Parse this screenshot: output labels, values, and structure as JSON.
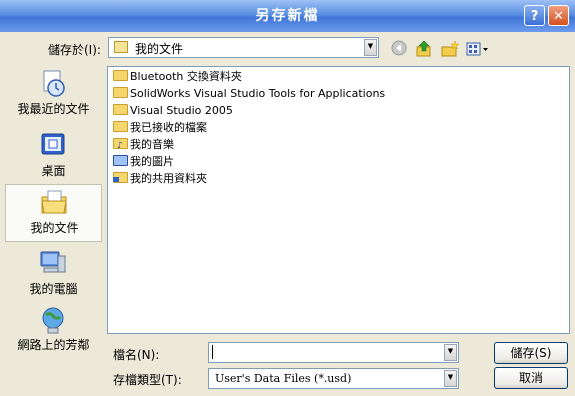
{
  "window": {
    "title": "另存新檔",
    "help_glyph": "?",
    "close_glyph": "✕"
  },
  "save_in": {
    "label": "儲存於(I):",
    "value": "我的文件"
  },
  "toolbar": {
    "icons": [
      "back-icon",
      "up-folder-icon",
      "new-folder-icon",
      "views-menu-icon"
    ]
  },
  "places": [
    {
      "label": "我最近的文件",
      "icon": "recent-documents-icon"
    },
    {
      "label": "桌面",
      "icon": "desktop-icon"
    },
    {
      "label": "我的文件",
      "icon": "my-documents-icon"
    },
    {
      "label": "我的電腦",
      "icon": "my-computer-icon"
    },
    {
      "label": "網路上的芳鄰",
      "icon": "network-places-icon"
    }
  ],
  "files": [
    {
      "name": "Bluetooth 交換資料夾",
      "icon": "folder-icon"
    },
    {
      "name": "SolidWorks Visual Studio Tools for Applications",
      "icon": "folder-icon"
    },
    {
      "name": "Visual Studio 2005",
      "icon": "folder-icon"
    },
    {
      "name": "我已接收的檔案",
      "icon": "folder-icon"
    },
    {
      "name": "我的音樂",
      "icon": "music-folder-icon"
    },
    {
      "name": "我的圖片",
      "icon": "pictures-folder-icon"
    },
    {
      "name": "我的共用資料夾",
      "icon": "shared-folder-icon"
    }
  ],
  "filename": {
    "label": "檔名(N):",
    "value": ""
  },
  "filetype": {
    "label": "存檔類型(T):",
    "value": "User's Data Files (*.usd)"
  },
  "buttons": {
    "save": "儲存(S)",
    "cancel": "取消"
  },
  "colors": {
    "title_bar": "#3f76d8",
    "folder": "#f5d66d",
    "selected_place": "#fafaf7"
  }
}
